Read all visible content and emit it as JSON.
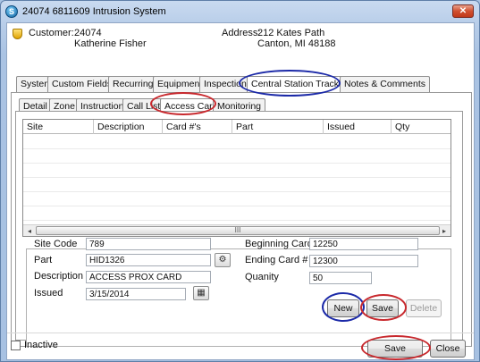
{
  "window": {
    "title": "24074 6811609  Intrusion System",
    "close_glyph": "✕",
    "app_icon_glyph": "S"
  },
  "header": {
    "customer_label": "Customer:",
    "customer_id": "24074",
    "customer_name": "Katherine Fisher",
    "address_label": "Address:",
    "address_line1": "212  Kates Path",
    "address_line2": "Canton, MI  48188"
  },
  "main_tabs": [
    "System",
    "Custom Fields",
    "Recurring",
    "Equipment",
    "Inspections",
    "Central Station Tracking",
    "Notes & Comments"
  ],
  "sub_tabs": [
    "Detail",
    "Zone",
    "Instruction",
    "Call List",
    "Access Cards",
    "Monitoring"
  ],
  "grid": {
    "columns": [
      "Site",
      "Description",
      "Card #'s",
      "Part",
      "Issued",
      "Qty"
    ],
    "rows": [],
    "scroll": {
      "left_glyph": "◂",
      "right_glyph": "▸",
      "thumb_glyph": "III"
    }
  },
  "form": {
    "site_code": {
      "label": "Site Code",
      "value": "789"
    },
    "part": {
      "label": "Part",
      "value": "HID1326"
    },
    "description": {
      "label": "Description",
      "value": "ACCESS PROX CARD"
    },
    "issued": {
      "label": "Issued",
      "value": "3/15/2014"
    },
    "beginning_card": {
      "label": "Beginning Card #",
      "value": "12250"
    },
    "ending_card": {
      "label": "Ending Card #",
      "value": "12300"
    },
    "quantity": {
      "label": "Quanity",
      "value": "50"
    },
    "lookup_glyph": "⚙",
    "calendar_glyph": "▦",
    "new_button": "New",
    "save_button": "Save",
    "delete_button": "Delete"
  },
  "footer": {
    "inactive_label": "Inactive",
    "save_button": "Save",
    "close_button": "Close"
  },
  "colors": {
    "annotation_blue": "#1c2aa8",
    "annotation_red": "#c8282d",
    "window_frame": "#a7c1e2"
  }
}
